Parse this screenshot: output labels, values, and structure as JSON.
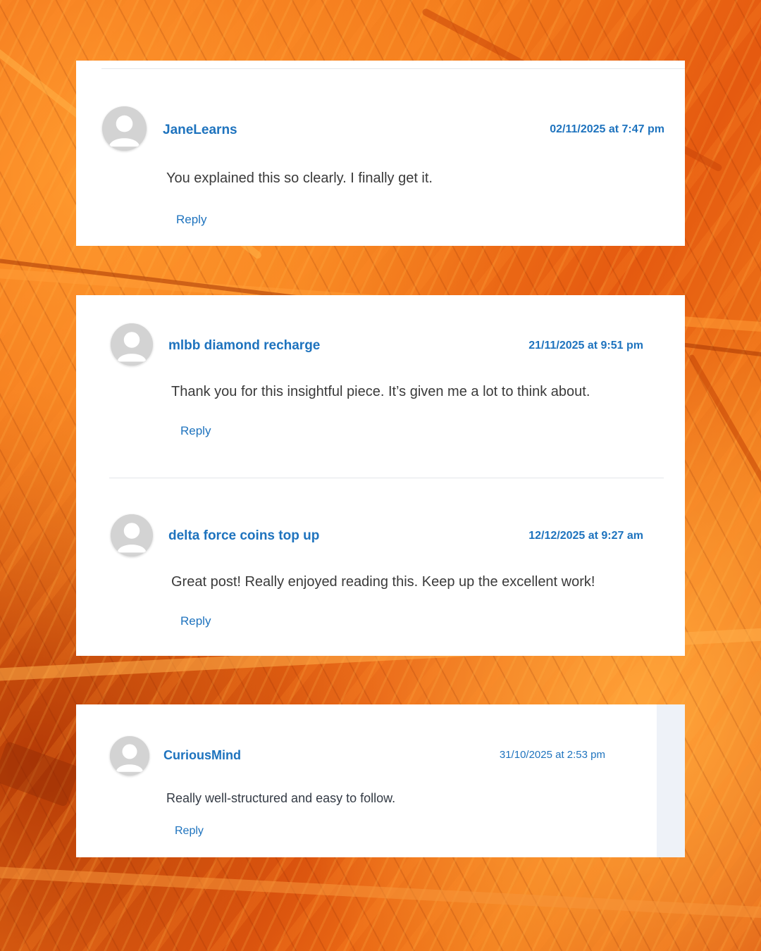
{
  "background": {
    "colors": [
      "#e9590f",
      "#f47d1c",
      "#b53a06",
      "#ffa43a"
    ]
  },
  "accent_color": "#1e73be",
  "comments": [
    {
      "author": "JaneLearns",
      "date": "02/11/2025 at 7:47 pm",
      "text": "You explained this so clearly. I finally get it.",
      "reply_label": "Reply",
      "avatar_icon": "default-user-icon"
    },
    {
      "author": "mlbb diamond recharge",
      "date": "21/11/2025 at 9:51 pm",
      "text": "Thank you for this insightful piece. It’s given me a lot to think about.",
      "reply_label": "Reply",
      "avatar_icon": "default-user-icon"
    },
    {
      "author": "delta force coins top up",
      "date": "12/12/2025 at 9:27 am",
      "text": "Great post! Really enjoyed reading this. Keep up the excellent work!",
      "reply_label": "Reply",
      "avatar_icon": "default-user-icon"
    },
    {
      "author": "CuriousMind",
      "date": "31/10/2025 at 2:53 pm",
      "text": "Really well-structured and easy to follow.",
      "reply_label": "Reply",
      "avatar_icon": "default-user-icon"
    }
  ]
}
